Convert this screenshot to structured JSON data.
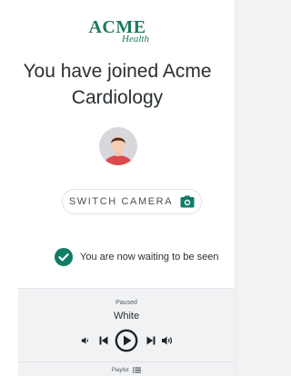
{
  "logo": {
    "brand": "ACME",
    "sub": "Health"
  },
  "title": "You have joined Acme Cardiology",
  "switch_camera": {
    "label": "SWITCH CAMERA",
    "icon": "camera-icon"
  },
  "status": {
    "text": "You are now waiting to be seen",
    "icon": "check-circle-icon"
  },
  "player": {
    "state": "Paused",
    "track": "White",
    "playlist_label": "Playlist",
    "controls": [
      "volume-down-icon",
      "skip-previous-icon",
      "play-icon",
      "skip-next-icon",
      "volume-up-icon"
    ]
  },
  "colors": {
    "brand_green": "#1d7a5b",
    "accent_teal": "#0f7d67",
    "avatar_shirt": "#e0484f",
    "avatar_bg": "#d6d8db"
  }
}
